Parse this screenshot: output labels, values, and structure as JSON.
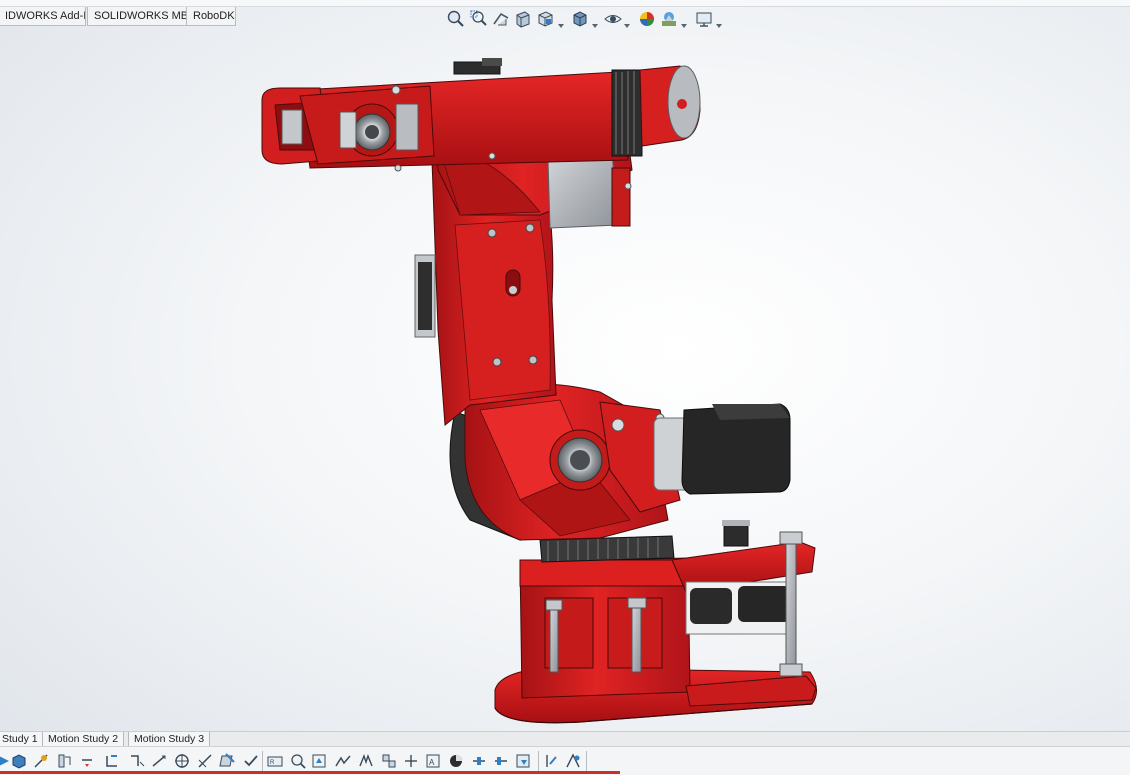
{
  "command_tabs": [
    {
      "label": "IDWORKS Add-Ins"
    },
    {
      "label": "SOLIDWORKS MBD"
    },
    {
      "label": "RoboDK"
    }
  ],
  "view_toolbar": {
    "icons": [
      "zoom-to-fit-icon",
      "zoom-to-area-icon",
      "previous-view-icon",
      "section-view-icon",
      "view-orientation-icon",
      "display-style-icon",
      "hide-show-items-icon",
      "edit-appearance-icon",
      "apply-scene-icon",
      "view-settings-icon"
    ]
  },
  "bottom_tabs": [
    {
      "label": "Study 1"
    },
    {
      "label": "Motion Study 2"
    },
    {
      "label": "Motion Study 3"
    }
  ],
  "motion_toolbar": {
    "icons": [
      "play-icon",
      "stop-icon",
      "motor-icon",
      "spring-icon",
      "damper-icon",
      "force-icon",
      "contact-icon",
      "gravity-icon",
      "results-icon",
      "plot-icon",
      "calculate-icon",
      "animation-wizard-icon",
      "autokey-icon",
      "add-key-icon",
      "mates-icon",
      "path-mate-icon",
      "sensor-icon",
      "explode-icon",
      "playback-speed-icon",
      "export-icon",
      "save-animation-icon",
      "properties-icon",
      "zoom-timeline-icon",
      "zoom-in-icon",
      "zoom-out-icon",
      "filter-icon",
      "collapse-icon",
      "expand-icon",
      "options-icon",
      "help-icon"
    ]
  },
  "colors": {
    "part_red": "#d81e1e",
    "part_red_dark": "#9c0f10",
    "motor_black": "#262626",
    "metal_gray": "#b8bcc0",
    "viewport_bg": "#f4f6f8"
  }
}
